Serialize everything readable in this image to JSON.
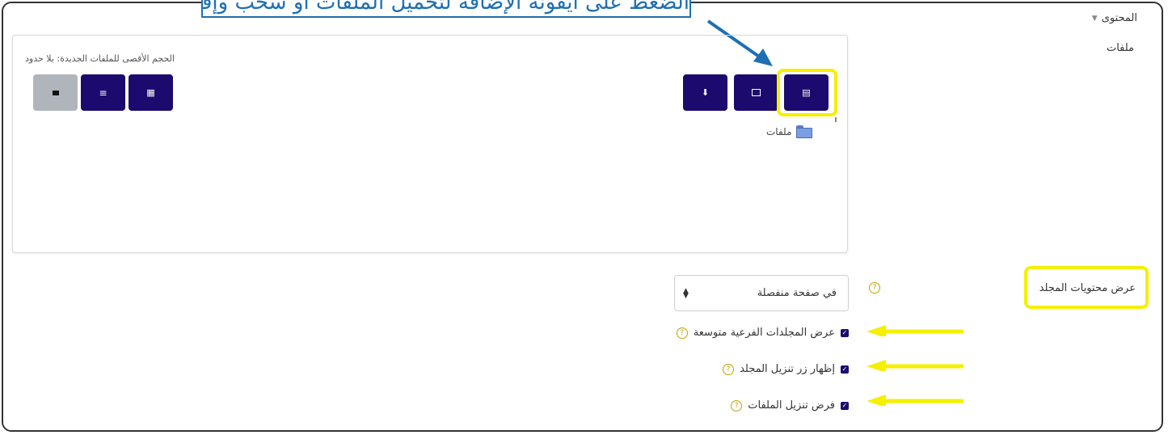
{
  "callout": {
    "text": "الضغط على أيقونة الإضافة لتحميل الملفات أو سحب وإفلات"
  },
  "section": {
    "title": "المحتوى"
  },
  "files_label": "ملفات",
  "filemanager": {
    "max_size_text": "الحجم الأقصى للملفات الجديدة: بلا حدود",
    "toolbar_left": [
      {
        "name": "view-folder-icon",
        "glyph": "▪"
      },
      {
        "name": "view-list-icon",
        "glyph": "≡"
      },
      {
        "name": "view-grid-icon",
        "glyph": "▦"
      }
    ],
    "toolbar_right": [
      {
        "name": "download-icon",
        "glyph": "⬇"
      },
      {
        "name": "create-folder-icon",
        "glyph": "▭"
      },
      {
        "name": "add-file-icon",
        "glyph": "▤"
      }
    ],
    "folder_name": "ملفات"
  },
  "display": {
    "label": "عرض محتويات المجلد",
    "select_value": "في صفحة منفصلة"
  },
  "checkboxes": [
    {
      "label": "عرض المجلدات الفرعية متوسعة",
      "checked": true
    },
    {
      "label": "إظهار زر تنزيل المجلد",
      "checked": true
    },
    {
      "label": "فرض تنزيل الملفات",
      "checked": true
    }
  ],
  "colors": {
    "accent": "#1d0a6e",
    "highlight": "#f4f000",
    "callout_border": "#1f6fb2"
  }
}
